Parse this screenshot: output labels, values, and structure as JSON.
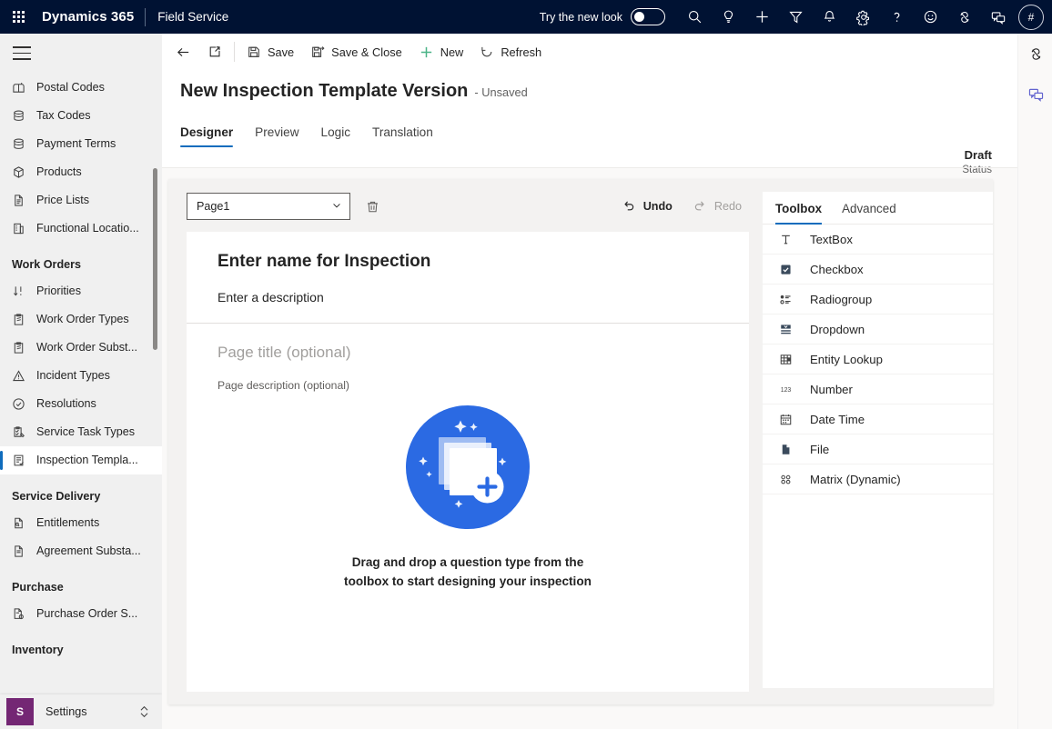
{
  "topbar": {
    "waffle": "app-launcher",
    "brand": "Dynamics 365",
    "app_name": "Field Service",
    "new_look_label": "Try the new look",
    "new_look_on": false,
    "icons": [
      "search-icon",
      "lightbulb-icon",
      "plus-icon",
      "filter-icon",
      "bell-icon",
      "gear-icon",
      "help-icon",
      "smiley-icon",
      "copilot-icon",
      "feedback-icon"
    ],
    "avatar_initials": "#",
    "bg_color": "#001233"
  },
  "sidebar": {
    "hamburger": "hamburger-icon",
    "items": [
      {
        "label": "Postal Codes",
        "icon": "mailbox-icon",
        "selected": false
      },
      {
        "label": "Tax Codes",
        "icon": "database-icon",
        "selected": false
      },
      {
        "label": "Payment Terms",
        "icon": "database-icon",
        "selected": false
      },
      {
        "label": "Products",
        "icon": "cube-icon",
        "selected": false
      },
      {
        "label": "Price Lists",
        "icon": "document-icon",
        "selected": false
      },
      {
        "label": "Functional Locatio...",
        "icon": "building-icon",
        "selected": false
      }
    ],
    "groups": [
      {
        "title": "Work Orders",
        "items": [
          {
            "label": "Priorities",
            "icon": "sort-icon",
            "selected": false
          },
          {
            "label": "Work Order Types",
            "icon": "clipboard-icon",
            "selected": false
          },
          {
            "label": "Work Order Subst...",
            "icon": "clipboard-icon",
            "selected": false
          },
          {
            "label": "Incident Types",
            "icon": "warning-icon",
            "selected": false
          },
          {
            "label": "Resolutions",
            "icon": "check-circle-icon",
            "selected": false
          },
          {
            "label": "Service Task Types",
            "icon": "task-icon",
            "selected": false
          },
          {
            "label": "Inspection Templa...",
            "icon": "inspection-icon",
            "selected": true
          }
        ]
      },
      {
        "title": "Service Delivery",
        "items": [
          {
            "label": "Entitlements",
            "icon": "entitlement-icon",
            "selected": false
          },
          {
            "label": "Agreement Substa...",
            "icon": "document-icon",
            "selected": false
          }
        ]
      },
      {
        "title": "Purchase",
        "items": [
          {
            "label": "Purchase Order S...",
            "icon": "purchase-icon",
            "selected": false
          }
        ]
      },
      {
        "title": "Inventory",
        "items": []
      }
    ],
    "settings": {
      "badge": "S",
      "label": "Settings",
      "badge_color": "#742774"
    }
  },
  "commandbar": {
    "back": "back-arrow-icon",
    "popout": "pop-out-icon",
    "buttons": [
      {
        "label": "Save",
        "icon": "save-icon"
      },
      {
        "label": "Save & Close",
        "icon": "save-close-icon"
      },
      {
        "label": "New",
        "icon": "plus-icon"
      },
      {
        "label": "Refresh",
        "icon": "refresh-icon"
      }
    ]
  },
  "form": {
    "title": "New Inspection Template Version",
    "subtitle": "- Unsaved",
    "status_value": "Draft",
    "status_label": "Status",
    "tabs": [
      {
        "label": "Designer",
        "active": true
      },
      {
        "label": "Preview",
        "active": false
      },
      {
        "label": "Logic",
        "active": false
      },
      {
        "label": "Translation",
        "active": false
      }
    ]
  },
  "designer": {
    "page_select_value": "Page1",
    "delete_icon": "trash-icon",
    "undo_label": "Undo",
    "redo_label": "Redo",
    "undo_enabled": true,
    "redo_enabled": false,
    "inspection_name_placeholder": "Enter name for Inspection",
    "inspection_description_placeholder": "Enter a description",
    "page_title_placeholder": "Page title (optional)",
    "page_description_placeholder": "Page description (optional)",
    "empty_state_message": "Drag and drop a question type from the toolbox to start designing your inspection",
    "empty_state_icon": "add-card-illustration",
    "accent_color": "#0f6cbd",
    "illustration_color": "#2b6ae3"
  },
  "toolbox": {
    "tabs": [
      {
        "label": "Toolbox",
        "active": true
      },
      {
        "label": "Advanced",
        "active": false
      }
    ],
    "items": [
      {
        "label": "TextBox",
        "icon": "textbox-icon"
      },
      {
        "label": "Checkbox",
        "icon": "checkbox-icon"
      },
      {
        "label": "Radiogroup",
        "icon": "radiogroup-icon"
      },
      {
        "label": "Dropdown",
        "icon": "dropdown-icon"
      },
      {
        "label": "Entity Lookup",
        "icon": "entity-lookup-icon"
      },
      {
        "label": "Number",
        "icon": "number-icon"
      },
      {
        "label": "Date Time",
        "icon": "calendar-icon"
      },
      {
        "label": "File",
        "icon": "file-icon"
      },
      {
        "label": "Matrix (Dynamic)",
        "icon": "matrix-icon"
      }
    ]
  },
  "rail": {
    "buttons": [
      "copilot-icon",
      "feedback-icon"
    ]
  }
}
